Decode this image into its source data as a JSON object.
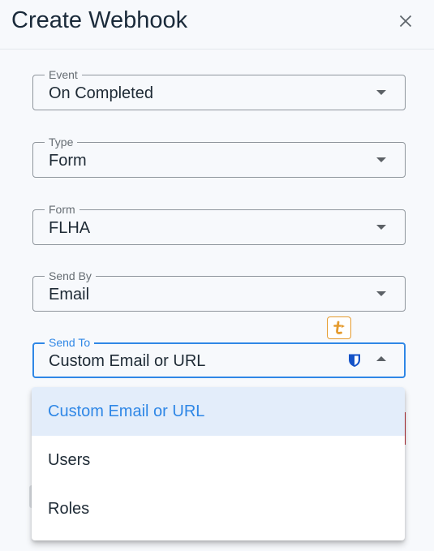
{
  "dialog": {
    "title": "Create Webhook",
    "close_icon": "close-icon"
  },
  "fields": {
    "event": {
      "label": "Event",
      "value": "On Completed"
    },
    "type": {
      "label": "Type",
      "value": "Form"
    },
    "form": {
      "label": "Form",
      "value": "FLHA"
    },
    "send_by": {
      "label": "Send By",
      "value": "Email"
    },
    "send_to": {
      "label": "Send To",
      "value": "Custom Email or URL",
      "state": "open"
    }
  },
  "dropdown": {
    "options": [
      {
        "label": "Custom Email or URL",
        "selected": true
      },
      {
        "label": "Users",
        "selected": false
      },
      {
        "label": "Roles",
        "selected": false
      }
    ]
  },
  "icons": {
    "password_manager": "shield-icon",
    "extension_badge": "extension-icon"
  },
  "colors": {
    "accent": "#2f87e6",
    "selected_bg": "#e3edfa",
    "badge": "#e59b2e"
  }
}
